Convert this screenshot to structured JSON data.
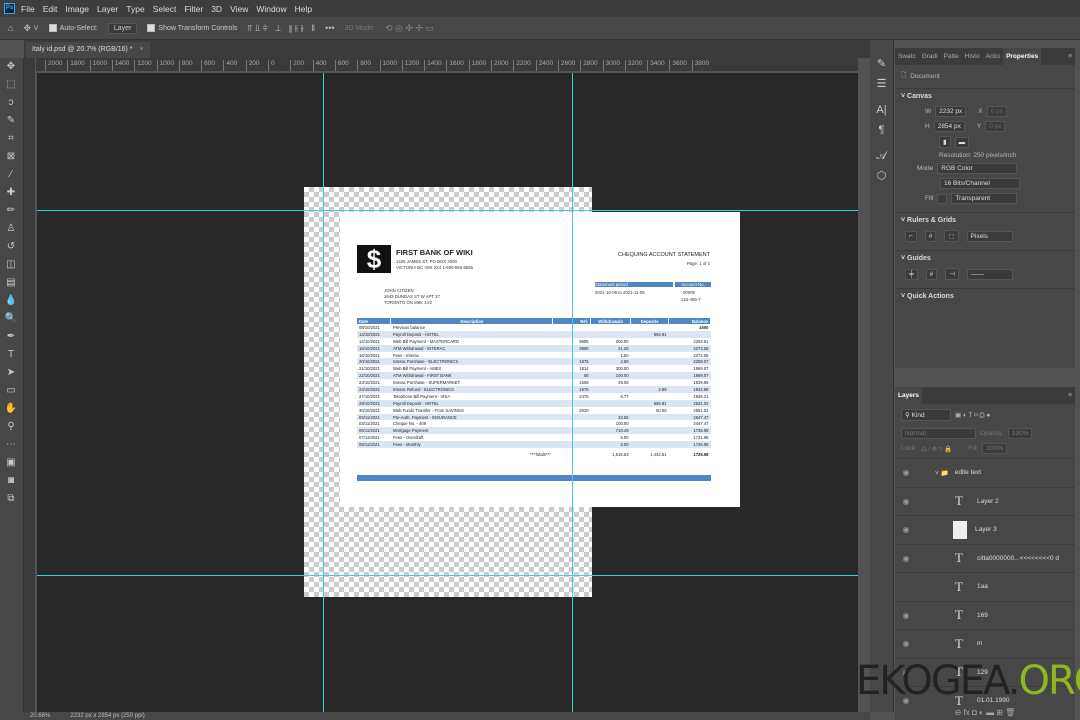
{
  "menu": {
    "items": [
      "File",
      "Edit",
      "Image",
      "Layer",
      "Type",
      "Select",
      "Filter",
      "3D",
      "View",
      "Window",
      "Help"
    ],
    "logo": "Ps"
  },
  "options": {
    "auto_select": "Auto-Select:",
    "auto_select_target": "Layer",
    "show_transform": "Show Transform Controls",
    "mode_3d": "3D Mode:"
  },
  "document_tab": {
    "title": "Italy id.psd @ 20.7% (RGB/16) *",
    "close": "×"
  },
  "ruler_labels": [
    "2000",
    "1800",
    "1600",
    "1400",
    "1200",
    "1000",
    "800",
    "600",
    "400",
    "200",
    "0",
    "200",
    "400",
    "600",
    "800",
    "1000",
    "1200",
    "1400",
    "1600",
    "1800",
    "2000",
    "2200",
    "2400",
    "2600",
    "2800",
    "3000",
    "3200",
    "3400",
    "3600",
    "3800"
  ],
  "statement": {
    "bank_name": "FIRST BANK OF WIKI",
    "logo_glyph": "$",
    "address1": "1425 JAMES ST, PO BOX 4000",
    "address2": "VICTORIA BC V8X 3X4 1-800-555-5555",
    "title": "CHEQUING ACCOUNT STATEMENT",
    "page": "Page: 1 of 1",
    "customer": [
      "JOHN CITIZEN",
      "1643 DUNDAS ST W APT 27",
      "TORONTO ON M6K 1V2"
    ],
    "period_label": "Statement period",
    "period": "2021-10-09 to 2021-11-08",
    "account_label": "Account No.",
    "account1": "00005",
    "account2": "123-456-7",
    "headers": [
      "Date",
      "Description",
      "Ref.",
      "Withdrawals",
      "Deposits",
      "Balance"
    ],
    "rows": [
      [
        "08/10/2021",
        "Previous balance",
        "",
        "",
        "",
        "1600"
      ],
      [
        "14/10/2021",
        "Payroll Deposit - HOTEL",
        "",
        "",
        "694.81",
        ""
      ],
      [
        "14/10/2021",
        "Web Bill Payment - MASTERCARD",
        "9685",
        "200.00",
        "",
        "2294.81"
      ],
      [
        "16/10/2021",
        "ATM Withdrawal - INTERAC",
        "3990",
        "21.25",
        "",
        "2273.56"
      ],
      [
        "16/10/2021",
        "Fees - Interac",
        "",
        "1.50",
        "",
        "2272.06"
      ],
      [
        "20/10/2021",
        "Interac Purchase - ELECTRONICS",
        "1975",
        "2.99",
        "",
        "2269.07"
      ],
      [
        "21/10/2021",
        "Web Bill Payment - AMEX",
        "1814",
        "300.00",
        "",
        "1969.07"
      ],
      [
        "22/10/2021",
        "ATM Withdrawal - FIRST BANK",
        "66",
        "100.00",
        "",
        "1869.07"
      ],
      [
        "23/10/2021",
        "Interac Purchase - SUPERMARKET",
        "1559",
        "29.08",
        "",
        "1839.99"
      ],
      [
        "24/10/2021",
        "Interac Refund - ELECTRONICS",
        "1975",
        "",
        "2.99",
        "1842.98"
      ],
      [
        "27/10/2021",
        "Telephone Bill Payment - VISA",
        "2475",
        "6.77",
        "",
        "1836.21"
      ],
      [
        "28/10/2021",
        "Payroll Deposit - HOTEL",
        "",
        "",
        "694.81",
        "2531.02"
      ],
      [
        "30/10/2021",
        "Web Funds Transfer - From SAVINGS",
        "2620",
        "",
        "50.00",
        "2581.02"
      ],
      [
        "03/11/2021",
        "Pre-Auth. Payment - INSURANCE",
        "",
        "33.55",
        "",
        "2547.47"
      ],
      [
        "03/11/2021",
        "Cheque No. - 409",
        "",
        "100.00",
        "",
        "2447.47"
      ],
      [
        "06/11/2021",
        "Mortgage Payment",
        "",
        "710.49",
        "",
        "1736.98"
      ],
      [
        "07/11/2021",
        "Fees - Overdraft",
        "",
        "5.00",
        "",
        "1731.98"
      ],
      [
        "08/11/2021",
        "Fees - Monthly",
        "",
        "5.00",
        "",
        "1726.98"
      ]
    ],
    "totals": [
      "***Totals***",
      "1,515.63",
      "1,442.61",
      "1726.98"
    ]
  },
  "properties": {
    "tabs": [
      "Swatc",
      "Gradi",
      "Patte",
      "Histo",
      "Actio",
      "Properties"
    ],
    "doc_label": "Document",
    "canvas": "Canvas",
    "w_label": "W",
    "w": "2232 px",
    "h_label": "H",
    "h": "2854 px",
    "x_label": "X",
    "y_label": "Y",
    "x": "0 px",
    "y": "0 px",
    "resolution": "Resolution: 250 pixels/inch",
    "mode_label": "Mode",
    "mode": "RGB Color",
    "depth": "16 Bits/Channel",
    "fill_label": "Fill",
    "fill": "Transparent",
    "rulers": "Rulers & Grids",
    "units": "Pixels",
    "guides": "Guides",
    "quick": "Quick Actions"
  },
  "layers": {
    "tab": "Layers",
    "kind": "Kind",
    "blend": "Normal",
    "opacity_label": "Opacity:",
    "opacity": "100%",
    "lock_label": "Lock:",
    "fill_label": "Fill:",
    "fill": "100%",
    "items": [
      {
        "name": "edite text",
        "type": "group"
      },
      {
        "name": "Layer 2",
        "type": "text"
      },
      {
        "name": "Layer 3",
        "type": "image"
      },
      {
        "name": "citta0000000...<<<<<<<<0 d",
        "type": "text"
      },
      {
        "name": "1aa",
        "type": "text",
        "hidden": true
      },
      {
        "name": "169",
        "type": "text"
      },
      {
        "name": "m",
        "type": "text"
      },
      {
        "name": "129",
        "type": "text"
      },
      {
        "name": "01.01.1990",
        "type": "text"
      }
    ]
  },
  "status": {
    "zoom": "20.66%",
    "size": "2232 px x 2854 px (250 ppi)"
  },
  "watermark": {
    "a": "EKOGEA.",
    "b": "ORG"
  },
  "colors": {
    "accent": "#4f86c6",
    "guide": "#3dd0d8",
    "canvas_bg": "#282828"
  }
}
